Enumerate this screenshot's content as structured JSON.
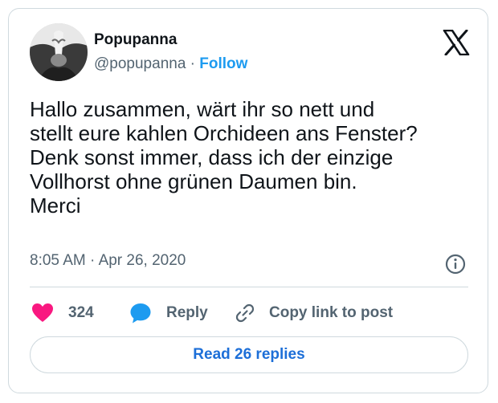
{
  "author": {
    "name": "Popupanna",
    "handle": "@popupanna",
    "separator": "·",
    "follow_label": "Follow"
  },
  "tweet": {
    "lines": [
      "Hallo zusammen, wärt ihr so nett und",
      "stellt eure kahlen Orchideen ans Fenster?",
      "Denk sonst immer, dass ich der einzige",
      "Vollhorst ohne grünen Daumen bin.",
      "Merci"
    ]
  },
  "meta": {
    "time": "8:05 AM",
    "separator": "·",
    "date": "Apr 26, 2020"
  },
  "actions": {
    "like_count": "324",
    "reply_label": "Reply",
    "copy_label": "Copy link to post"
  },
  "read_replies_label": "Read 26 replies",
  "colors": {
    "like": "#f91880",
    "accent": "#1d9bf0",
    "read_replies": "#1d6fd8",
    "muted": "#536471",
    "border": "#cfd9de"
  },
  "icons": {
    "brand": "x-logo-icon",
    "info": "info-icon",
    "like": "heart-icon",
    "reply": "speech-bubble-icon",
    "copy": "link-icon"
  }
}
